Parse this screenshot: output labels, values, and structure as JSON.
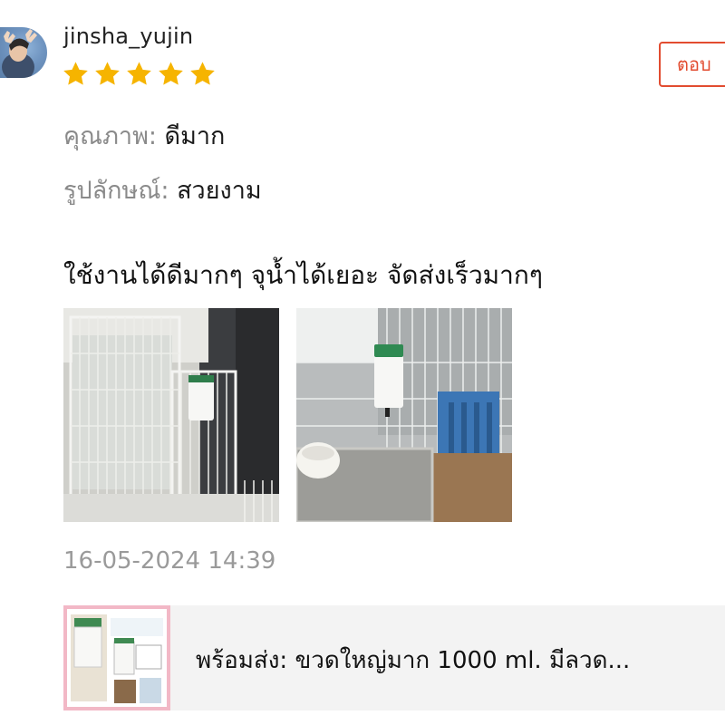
{
  "review": {
    "username": "jinsha_yujin",
    "rating": 5,
    "reply_label": "ตอบ",
    "attributes": [
      {
        "key": "คุณภาพ: ",
        "value": "ดีมาก"
      },
      {
        "key": "รูปลักษณ์: ",
        "value": "สวยงาม"
      }
    ],
    "text": "ใช้งานได้ดีมากๆ จุน้ำได้เยอะ จัดส่งเร็วมากๆ",
    "timestamp": "16-05-2024 14:39"
  },
  "product": {
    "name": "พร้อมส่ง: ขวดใหญ่มาก 1000 ml. มีลวด..."
  },
  "colors": {
    "star": "#f6b400",
    "accent": "#e24c30",
    "muted_text": "#9a9a9a",
    "product_bar_bg": "#f3f3f3"
  }
}
